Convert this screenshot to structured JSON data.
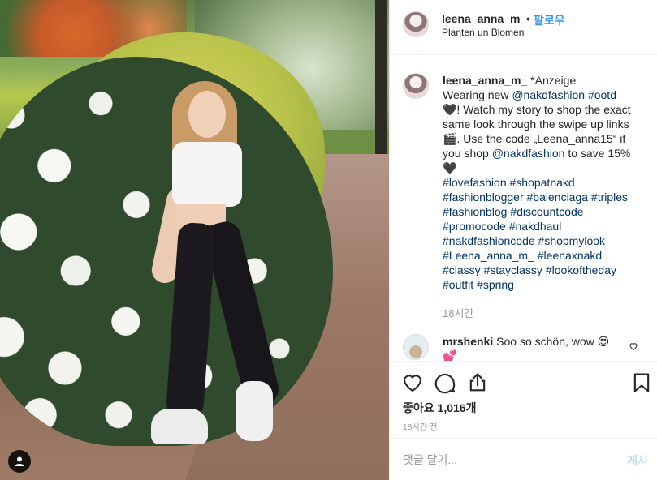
{
  "post": {
    "username": "leena_anna_m_",
    "dot": "•",
    "follow_label": "팔로우",
    "location": "Planten un Blomen"
  },
  "caption": {
    "username": "leena_anna_m_",
    "line1": " *Anzeige",
    "line2_pre": "Wearing new ",
    "mention1": "@nakdfashion",
    "hashtag_ootd": "#ootd",
    "line3": "🖤! Watch my story to shop the exact same look through the swipe up links🎬. Use the code „Leena_anna15“ if you shop ",
    "mention2": "@nakdfashion",
    "line4": " to save 15% 🖤",
    "hashtags": "#lovefashion #shopatnakd #fashionblogger #balenciaga #triples #fashionblog #discountcode #promocode #nakdhaul #nakdfashioncode #shopmylook #Leena_anna_m_ #leenaxnakd #classy #stayclassy #lookoftheday #outfit #spring",
    "time": "18시간"
  },
  "comment": {
    "username": "mrshenki",
    "text": " Soo so schön, wow 😍💕"
  },
  "likes": {
    "text": "좋아요 1,016개"
  },
  "time_ago": "18시간 전",
  "add_comment": {
    "placeholder": "댓글 달기...",
    "post_label": "게시"
  },
  "icons": [
    "heart-icon",
    "comment-icon",
    "share-icon",
    "bookmark-icon",
    "user-tag-icon"
  ],
  "colors": {
    "link": "#003569",
    "follow": "#3897f0",
    "post_disabled": "#b2dffc"
  }
}
